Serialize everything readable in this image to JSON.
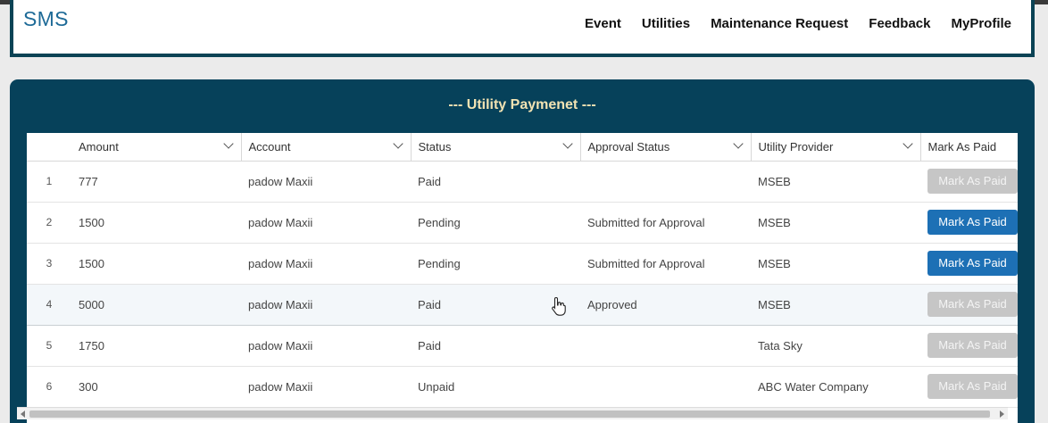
{
  "app": {
    "brand": "SMS"
  },
  "nav": [
    {
      "label": "Event"
    },
    {
      "label": "Utilities"
    },
    {
      "label": "Maintenance Request"
    },
    {
      "label": "Feedback"
    },
    {
      "label": "MyProfile"
    }
  ],
  "card": {
    "title": "--- Utility Paymenet ---"
  },
  "table": {
    "columns": [
      "Amount",
      "Account",
      "Status",
      "Approval Status",
      "Utility Provider",
      "Mark As Paid"
    ],
    "rows": [
      {
        "index": "1",
        "amount": "777",
        "account": "padow Maxii",
        "status": "Paid",
        "approval": "",
        "provider": "MSEB",
        "action": "Mark As Paid",
        "action_enabled": false
      },
      {
        "index": "2",
        "amount": "1500",
        "account": "padow Maxii",
        "status": "Pending",
        "approval": "Submitted for Approval",
        "provider": "MSEB",
        "action": "Mark As Paid",
        "action_enabled": true
      },
      {
        "index": "3",
        "amount": "1500",
        "account": "padow Maxii",
        "status": "Pending",
        "approval": "Submitted for Approval",
        "provider": "MSEB",
        "action": "Mark As Paid",
        "action_enabled": true
      },
      {
        "index": "4",
        "amount": "5000",
        "account": "padow Maxii",
        "status": "Paid",
        "approval": "Approved",
        "provider": "MSEB",
        "action": "Mark As Paid",
        "action_enabled": false
      },
      {
        "index": "5",
        "amount": "1750",
        "account": "padow Maxii",
        "status": "Paid",
        "approval": "",
        "provider": "Tata Sky",
        "action": "Mark As Paid",
        "action_enabled": false
      },
      {
        "index": "6",
        "amount": "300",
        "account": "padow Maxii",
        "status": "Unpaid",
        "approval": "",
        "provider": "ABC Water Company",
        "action": "Mark As Paid",
        "action_enabled": false
      }
    ]
  },
  "colors": {
    "header_border": "#0b4355",
    "card_bg": "#06415a",
    "title_color": "#f2e3b3",
    "brand_color": "#1d6a97",
    "button_active": "#1d70b5",
    "button_disabled": "#c6c6c6"
  },
  "icons": [
    "chevron-down-icon",
    "hand-cursor-icon",
    "scroll-left-icon",
    "scroll-right-icon"
  ]
}
